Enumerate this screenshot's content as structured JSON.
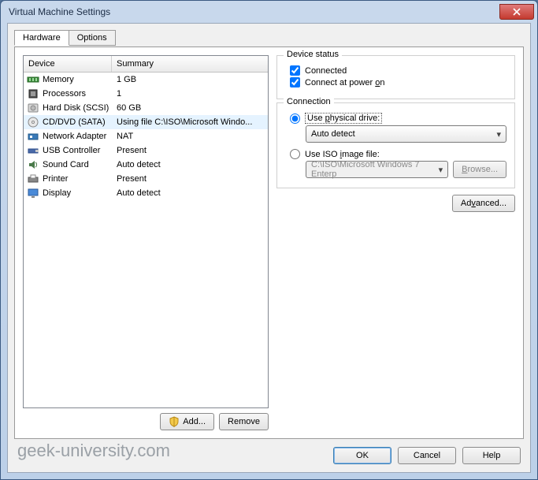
{
  "title": "Virtual Machine Settings",
  "tabs": {
    "hardware": "Hardware",
    "options": "Options"
  },
  "columns": {
    "device": "Device",
    "summary": "Summary"
  },
  "devices": [
    {
      "name": "Memory",
      "summary": "1 GB",
      "icon": "memory-icon"
    },
    {
      "name": "Processors",
      "summary": "1",
      "icon": "cpu-icon"
    },
    {
      "name": "Hard Disk (SCSI)",
      "summary": "60 GB",
      "icon": "hdd-icon"
    },
    {
      "name": "CD/DVD (SATA)",
      "summary": "Using file C:\\ISO\\Microsoft Windo...",
      "icon": "disc-icon",
      "selected": true
    },
    {
      "name": "Network Adapter",
      "summary": "NAT",
      "icon": "nic-icon"
    },
    {
      "name": "USB Controller",
      "summary": "Present",
      "icon": "usb-icon"
    },
    {
      "name": "Sound Card",
      "summary": "Auto detect",
      "icon": "sound-icon"
    },
    {
      "name": "Printer",
      "summary": "Present",
      "icon": "printer-icon"
    },
    {
      "name": "Display",
      "summary": "Auto detect",
      "icon": "display-icon"
    }
  ],
  "left_buttons": {
    "add": "Add...",
    "remove": "Remove"
  },
  "status_group": {
    "title": "Device status",
    "connected": "Connected",
    "connect_poweron": "Connect at power on"
  },
  "connection_group": {
    "title": "Connection",
    "use_physical": "Use physical drive:",
    "physical_value": "Auto detect",
    "use_iso": "Use ISO image file:",
    "iso_value": "C:\\ISO\\Microsoft Windows 7 Enterp",
    "browse": "Browse..."
  },
  "advanced": "Advanced...",
  "bottom": {
    "ok": "OK",
    "cancel": "Cancel",
    "help": "Help"
  },
  "watermark": "geek-university.com"
}
